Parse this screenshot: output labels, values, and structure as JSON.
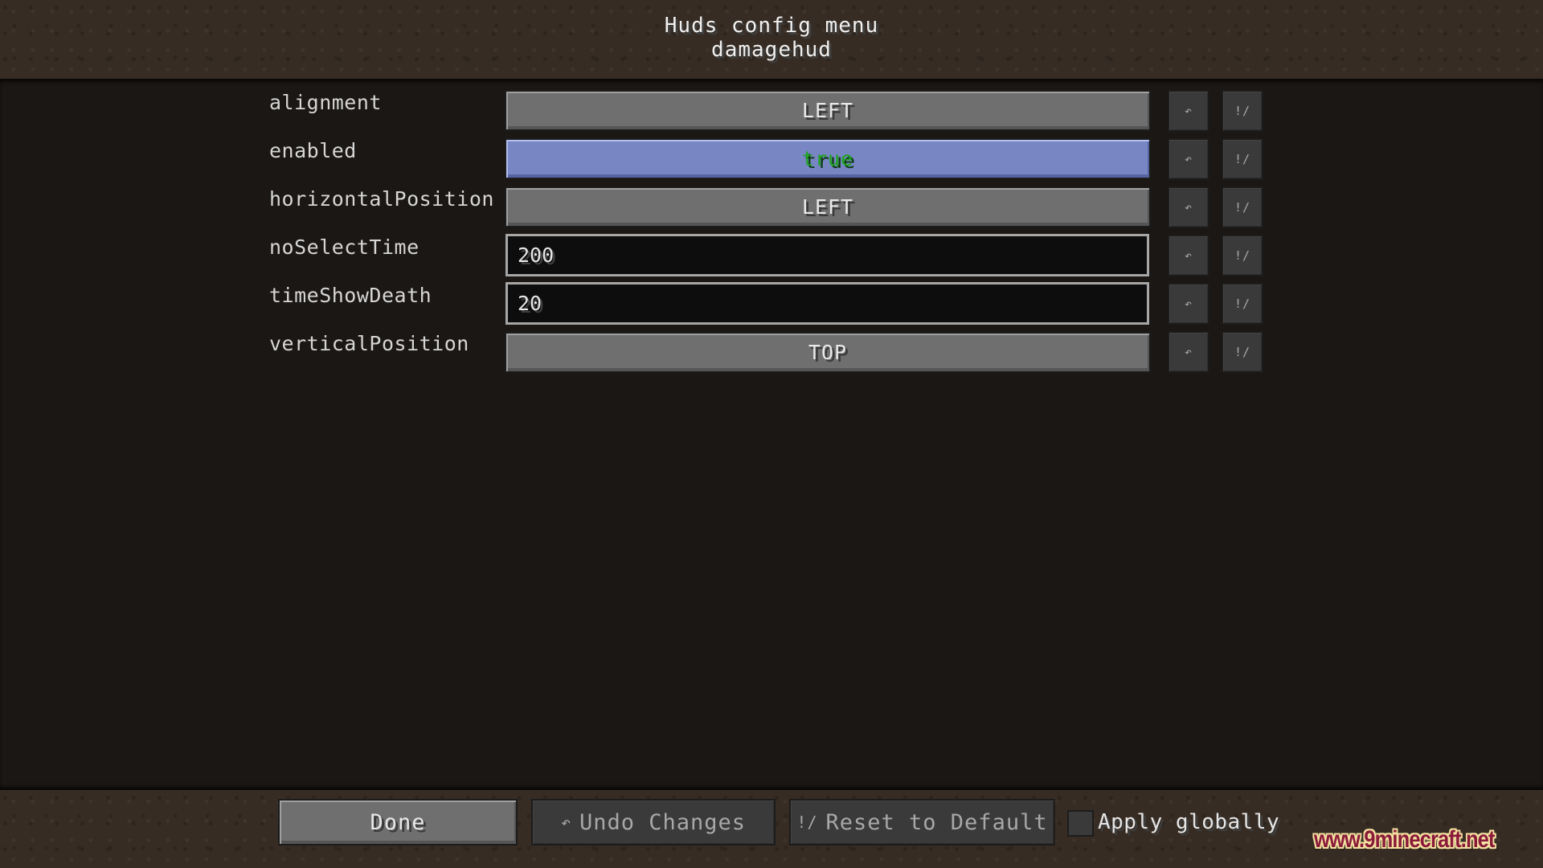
{
  "header": {
    "title": "Huds config menu",
    "subtitle": "damagehud"
  },
  "entries": [
    {
      "label": "alignment",
      "type": "button",
      "value": "LEFT"
    },
    {
      "label": "enabled",
      "type": "toggle",
      "value": "true",
      "value_color": "#1aa61a",
      "state": "hovered"
    },
    {
      "label": "horizontalPosition",
      "type": "button",
      "value": "LEFT"
    },
    {
      "label": "noSelectTime",
      "type": "text",
      "value": "200"
    },
    {
      "label": "timeShowDeath",
      "type": "text",
      "value": "20"
    },
    {
      "label": "verticalPosition",
      "type": "button",
      "value": "TOP"
    }
  ],
  "row_icons": {
    "undo": "↶",
    "reset": "!/"
  },
  "footer": {
    "done_label": "Done",
    "undo_label": "Undo Changes",
    "undo_icon": "↶",
    "reset_label": "Reset to Default",
    "reset_icon": "!/",
    "apply_globally_label": "Apply globally",
    "apply_globally_checked": false
  },
  "watermark": "www.9minecraft.net"
}
